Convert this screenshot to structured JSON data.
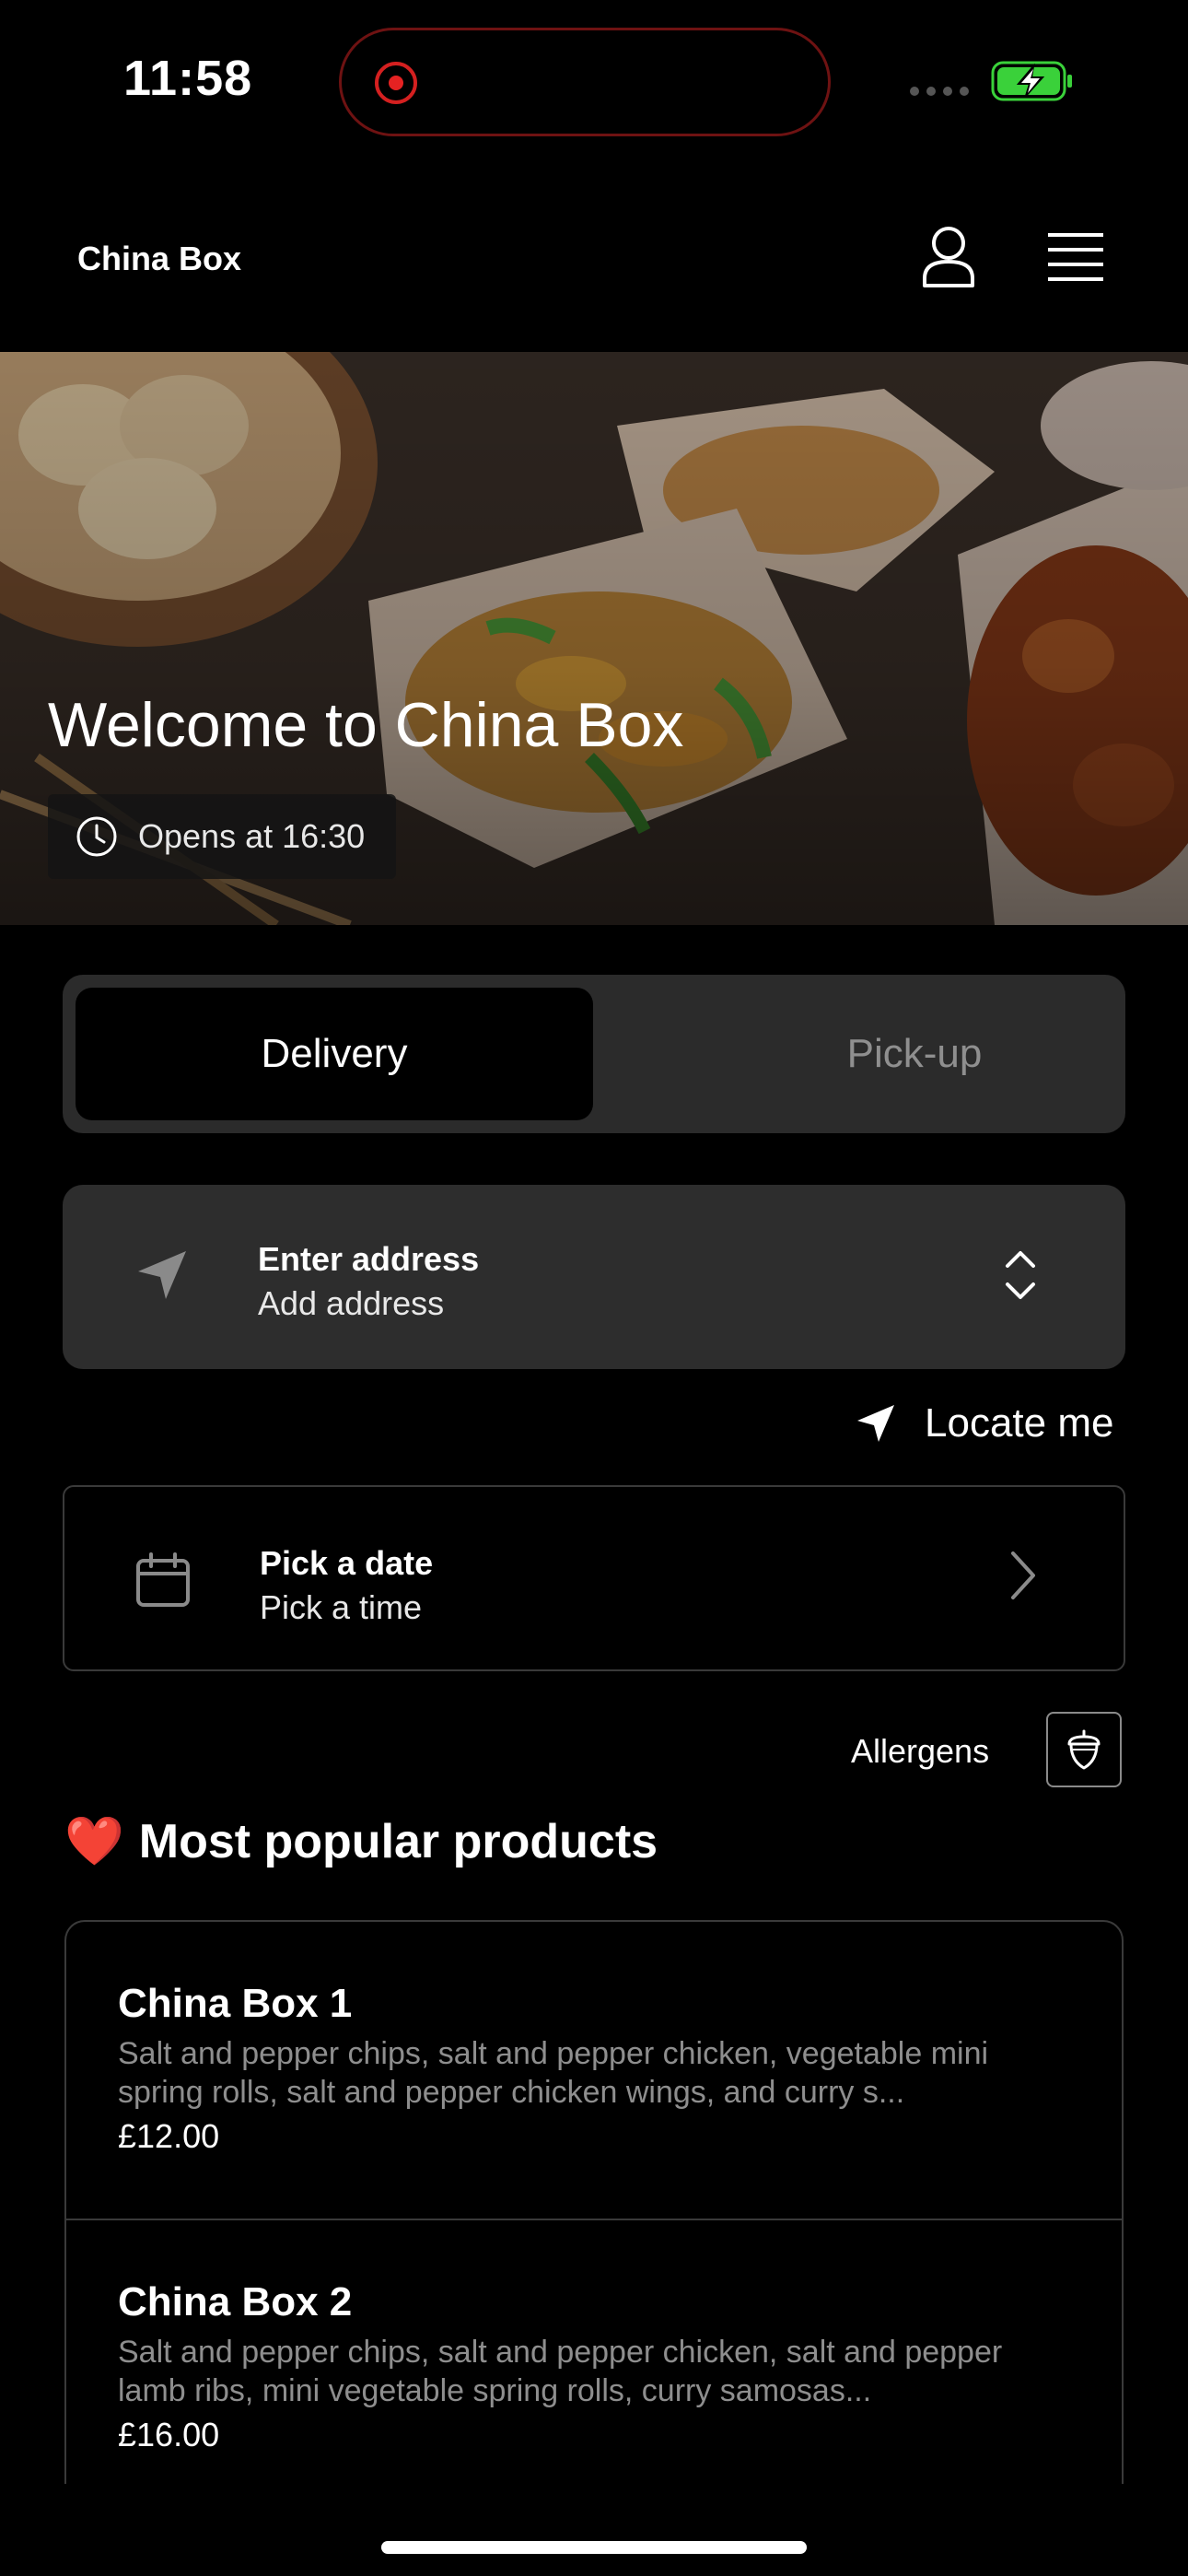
{
  "status_bar": {
    "time": "11:58"
  },
  "header": {
    "brand": "China Box"
  },
  "hero": {
    "title": "Welcome to China Box",
    "hours": "Opens at 16:30"
  },
  "mode": {
    "delivery": "Delivery",
    "pickup": "Pick-up",
    "selected": "Delivery"
  },
  "address": {
    "title": "Enter address",
    "subtitle": "Add address"
  },
  "locate": {
    "label": "Locate me"
  },
  "schedule": {
    "title": "Pick a date",
    "subtitle": "Pick a time"
  },
  "allergens": {
    "label": "Allergens"
  },
  "popular": {
    "emoji": "❤️",
    "title": "Most popular products",
    "items": [
      {
        "name": "China Box 1",
        "description": "Salt and pepper chips, salt and pepper chicken, vegetable mini spring rolls, salt and pepper chicken wings, and curry s...",
        "price": "£12.00"
      },
      {
        "name": "China Box 2",
        "description": "Salt and pepper chips, salt and pepper chicken, salt and pepper lamb ribs, mini vegetable spring rolls, curry samosas...",
        "price": "£16.00"
      }
    ]
  },
  "colors": {
    "background": "#000000",
    "card": "#2d2d2d",
    "record": "#e52222",
    "battery": "#3ad13a"
  }
}
